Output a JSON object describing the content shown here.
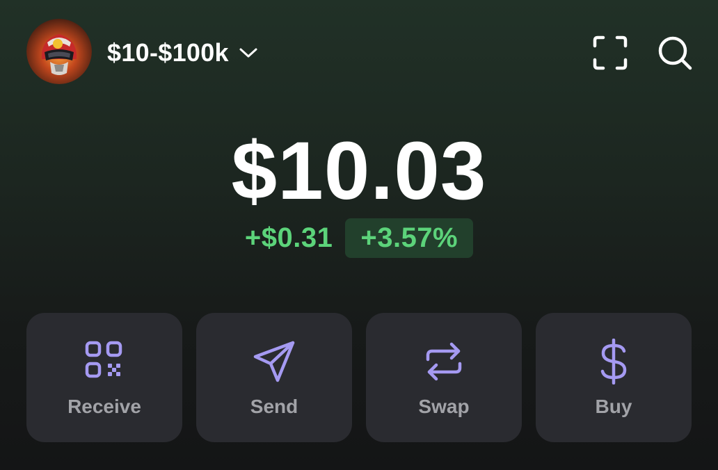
{
  "header": {
    "account_name": "$10-$100k",
    "avatar_icon": "helmet-rider-avatar",
    "scan_icon": "scan-icon",
    "search_icon": "search-icon"
  },
  "balance": {
    "amount": "$10.03",
    "change_amount": "+$0.31",
    "change_percent": "+3.57%",
    "positive_color": "#5cd37a"
  },
  "actions": [
    {
      "label": "Receive",
      "icon": "qr-code-icon"
    },
    {
      "label": "Send",
      "icon": "paper-plane-icon"
    },
    {
      "label": "Swap",
      "icon": "swap-arrows-icon"
    },
    {
      "label": "Buy",
      "icon": "dollar-sign-icon"
    }
  ],
  "colors": {
    "accent": "#a59af2",
    "button_bg": "#2a2b30",
    "button_label": "#a2a3a8"
  }
}
